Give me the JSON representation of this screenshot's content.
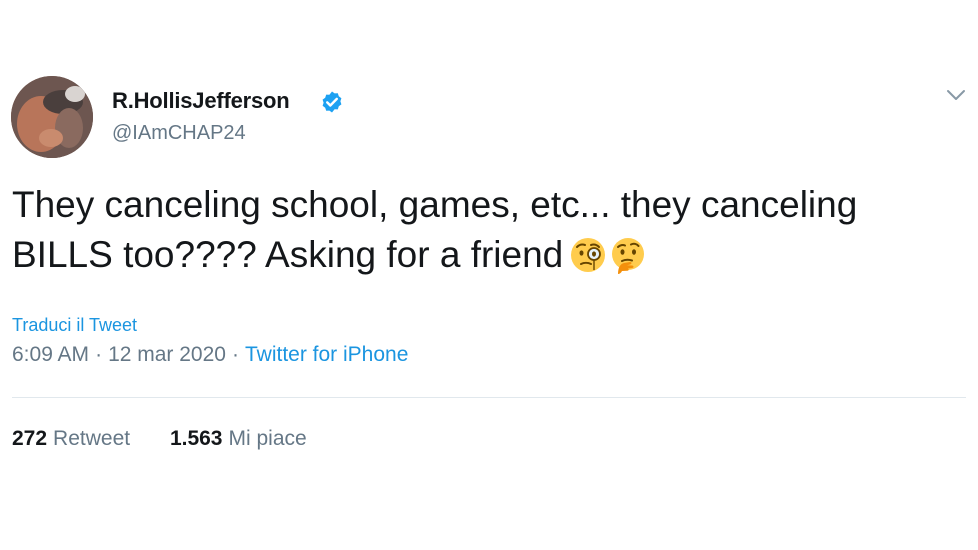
{
  "user": {
    "display_name": "R.HollisJefferson",
    "handle": "@IAmCHAP24",
    "verified": true
  },
  "tweet": {
    "text": "They canceling school, games, etc... they canceling BILLS too???? Asking for a friend",
    "emojis": [
      "face-with-monocle",
      "thinking-face"
    ],
    "translate_label": "Traduci il Tweet",
    "time": "6:09 AM",
    "date": "12 mar 2020",
    "separator": "·",
    "source": "Twitter for iPhone"
  },
  "stats": {
    "retweets_count": "272",
    "retweets_label": "Retweet",
    "likes_count": "1.563",
    "likes_label": "Mi piace"
  },
  "colors": {
    "link": "#1b95e0",
    "secondary_text": "#657786",
    "primary_text": "#14171a",
    "verified_badge": "#1da1f2",
    "divider": "#e1e8ed"
  },
  "icons": {
    "verified": "verified-badge-icon",
    "more": "chevron-down-icon"
  }
}
